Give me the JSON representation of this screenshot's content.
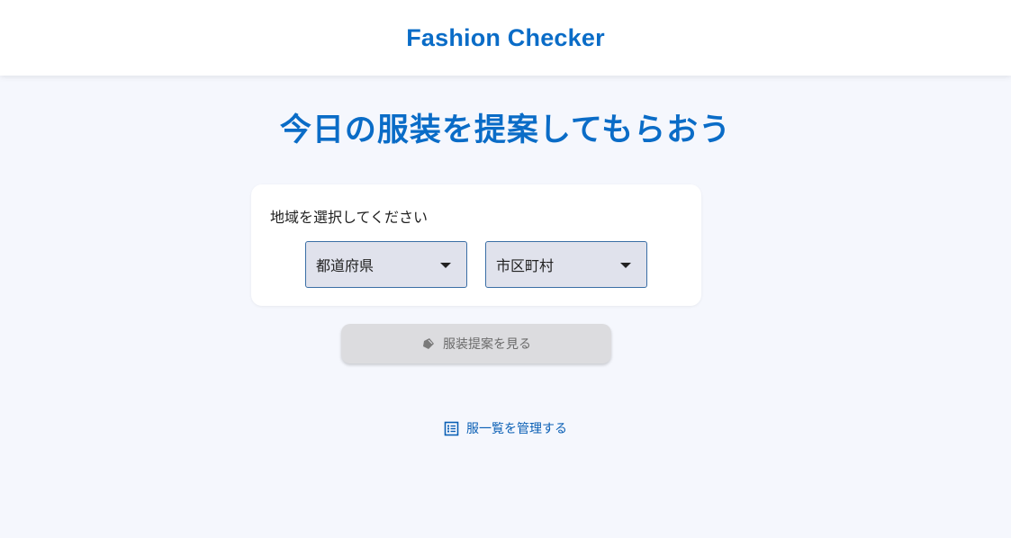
{
  "header": {
    "title": "Fashion Checker"
  },
  "main": {
    "heading": "今日の服装を提案してもらおう",
    "region_card": {
      "label": "地域を選択してください",
      "prefecture_select": {
        "value": "都道府県",
        "icon": "arrow-drop-down-icon"
      },
      "city_select": {
        "value": "市区町村",
        "icon": "arrow-drop-down-icon"
      }
    },
    "suggest_button": {
      "label": "服装提案を見る",
      "icon": "hanger-icon",
      "state": "disabled"
    },
    "manage_link": {
      "label": "服一覧を管理する",
      "icon": "list-icon"
    }
  },
  "colors": {
    "accent": "#0a6cc7",
    "background": "#f5f7fd",
    "select_fill": "#e0e2ec",
    "select_border": "#3a6ea5",
    "disabled_button": "#dcdcdf"
  }
}
